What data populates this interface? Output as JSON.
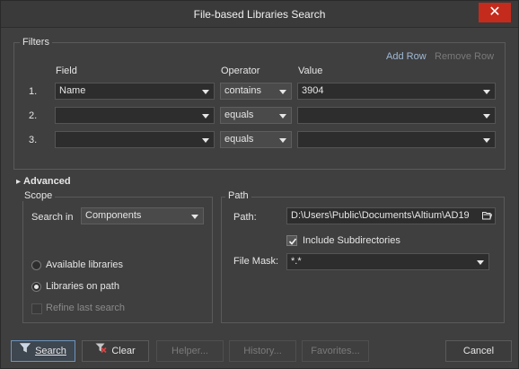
{
  "window": {
    "title": "File-based Libraries Search",
    "close_glyph": "✕"
  },
  "filters": {
    "label": "Filters",
    "add_row": "Add Row",
    "remove_row": "Remove Row",
    "col_field": "Field",
    "col_operator": "Operator",
    "col_value": "Value",
    "rows": [
      {
        "num": "1.",
        "field": "Name",
        "operator": "contains",
        "value": "3904"
      },
      {
        "num": "2.",
        "field": "",
        "operator": "equals",
        "value": ""
      },
      {
        "num": "3.",
        "field": "",
        "operator": "equals",
        "value": ""
      }
    ]
  },
  "advanced": {
    "label": "Advanced",
    "toggle_glyph": "▸"
  },
  "scope": {
    "label": "Scope",
    "search_in_label": "Search in",
    "search_in_value": "Components",
    "available_libraries": "Available libraries",
    "libraries_on_path": "Libraries on path",
    "refine_last_search": "Refine last search"
  },
  "path": {
    "label": "Path",
    "path_label": "Path:",
    "path_value": "D:\\Users\\Public\\Documents\\Altium\\AD19",
    "include_subdirectories": "Include Subdirectories",
    "file_mask_label": "File Mask:",
    "file_mask_value": "*.*"
  },
  "footer": {
    "search": "Search",
    "clear": "Clear",
    "helper": "Helper...",
    "history": "History...",
    "favorites": "Favorites...",
    "cancel": "Cancel"
  }
}
